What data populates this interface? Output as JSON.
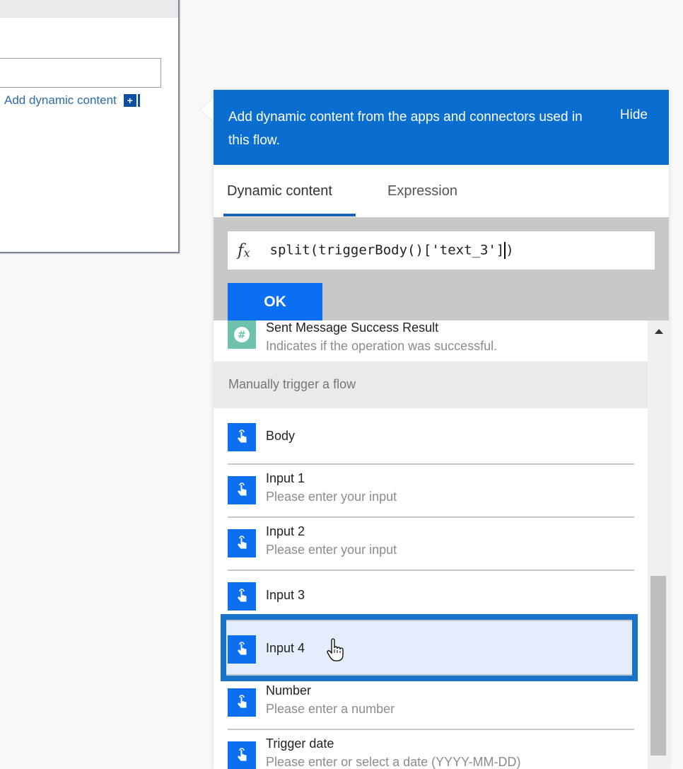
{
  "left_card": {
    "add_dynamic_label": "Add dynamic content",
    "add_icon": "plus-icon"
  },
  "panel": {
    "header_text": "Add dynamic content from the apps and connectors used in this flow.",
    "hide_label": "Hide",
    "tabs": [
      {
        "label": "Dynamic content",
        "active": true
      },
      {
        "label": "Expression",
        "active": false
      }
    ],
    "expression": {
      "fx_label": "f",
      "fx_sub": "x",
      "value": "split(triggerBody()['text_3']",
      "value_after_cursor": ")"
    },
    "ok_label": "OK",
    "list": {
      "top_item": {
        "title": "Sent Message Success Result",
        "desc": "Indicates if the operation was successful.",
        "icon": "slack-hash-icon"
      },
      "section_title": "Manually trigger a flow",
      "items": [
        {
          "title": "Body",
          "desc": "",
          "icon": "manual-trigger-icon"
        },
        {
          "title": "Input 1",
          "desc": "Please enter your input",
          "icon": "manual-trigger-icon"
        },
        {
          "title": "Input 2",
          "desc": "Please enter your input",
          "icon": "manual-trigger-icon"
        },
        {
          "title": "Input 3",
          "desc": "",
          "icon": "manual-trigger-icon"
        },
        {
          "title": "Input 4",
          "desc": "",
          "icon": "manual-trigger-icon",
          "highlighted": true
        },
        {
          "title": "Number",
          "desc": "Please enter a number",
          "icon": "manual-trigger-icon"
        },
        {
          "title": "Trigger date",
          "desc": "Please enter or select a date (YYYY-MM-DD)",
          "icon": "manual-trigger-icon"
        }
      ]
    }
  },
  "colors": {
    "header_blue": "#0a6ed1",
    "ok_blue": "#0a6ff2",
    "highlight_border": "#1a73c8",
    "highlight_bg": "#e3edfb",
    "trigger_icon_blue": "#0b6ff0",
    "slack_teal": "#6ec2ad"
  }
}
